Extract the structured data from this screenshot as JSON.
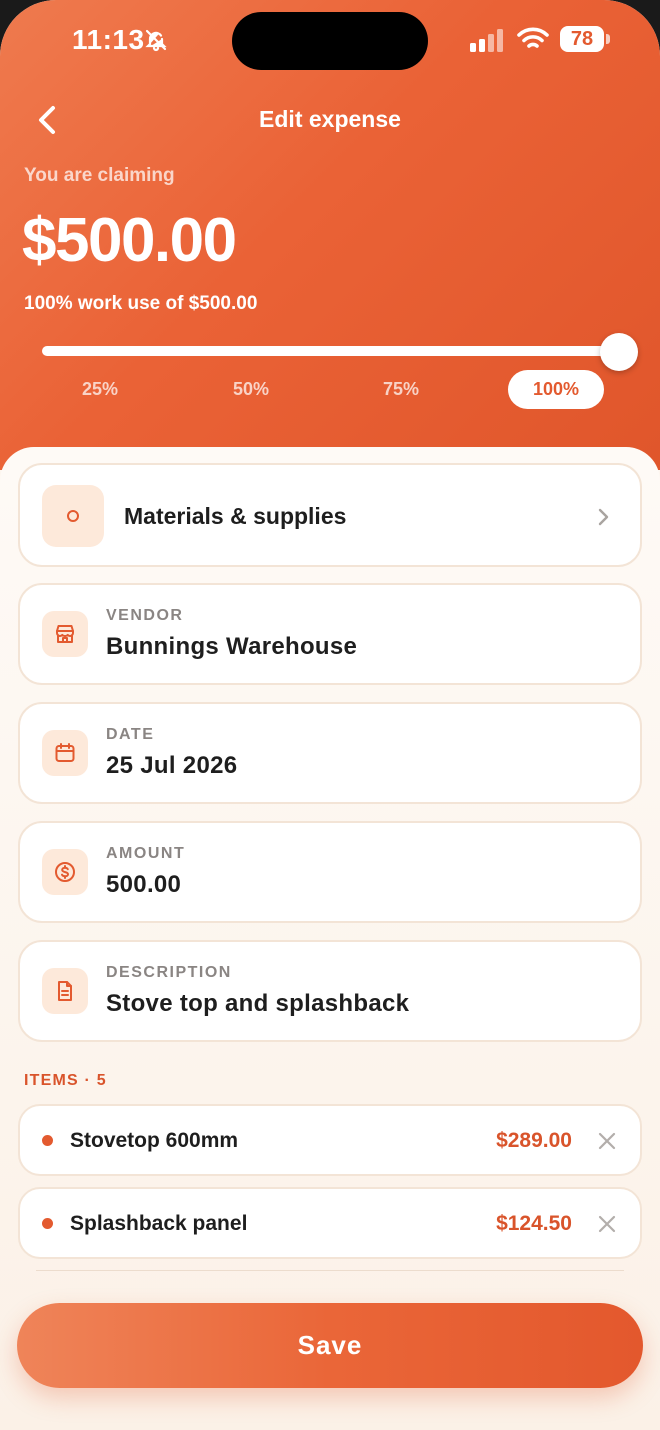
{
  "status_bar": {
    "time": "11:13",
    "battery": "78"
  },
  "nav": {
    "title": "Edit expense"
  },
  "summary": {
    "claiming_label": "You are claiming",
    "amount": "$500.00",
    "work_use_text": "100% work use of $500.00",
    "work_use_percent": 100
  },
  "presets": [
    "25%",
    "50%",
    "75%",
    "100%"
  ],
  "selected_preset": "100%",
  "category": {
    "label": "Materials & supplies"
  },
  "fields": [
    {
      "label": "VENDOR",
      "value": "Bunnings Warehouse",
      "icon": "store-icon"
    },
    {
      "label": "DATE",
      "value": "25 Jul 2026",
      "icon": "calendar-icon"
    },
    {
      "label": "AMOUNT",
      "value": "500.00",
      "icon": "dollar-circle-icon"
    },
    {
      "label": "DESCRIPTION",
      "value": "Stove top and splashback",
      "icon": "document-icon"
    }
  ],
  "items_header": "ITEMS · 5",
  "items": [
    {
      "name": "Stovetop 600mm",
      "price": "$289.00"
    },
    {
      "name": "Splashback panel",
      "price": "$124.50"
    }
  ],
  "save_label": "Save",
  "colors": {
    "accent": "#E35A2F",
    "accent_light": "#FDE9DA",
    "header_gradient_start": "#EF7A4E",
    "header_gradient_end": "#E0562B"
  }
}
